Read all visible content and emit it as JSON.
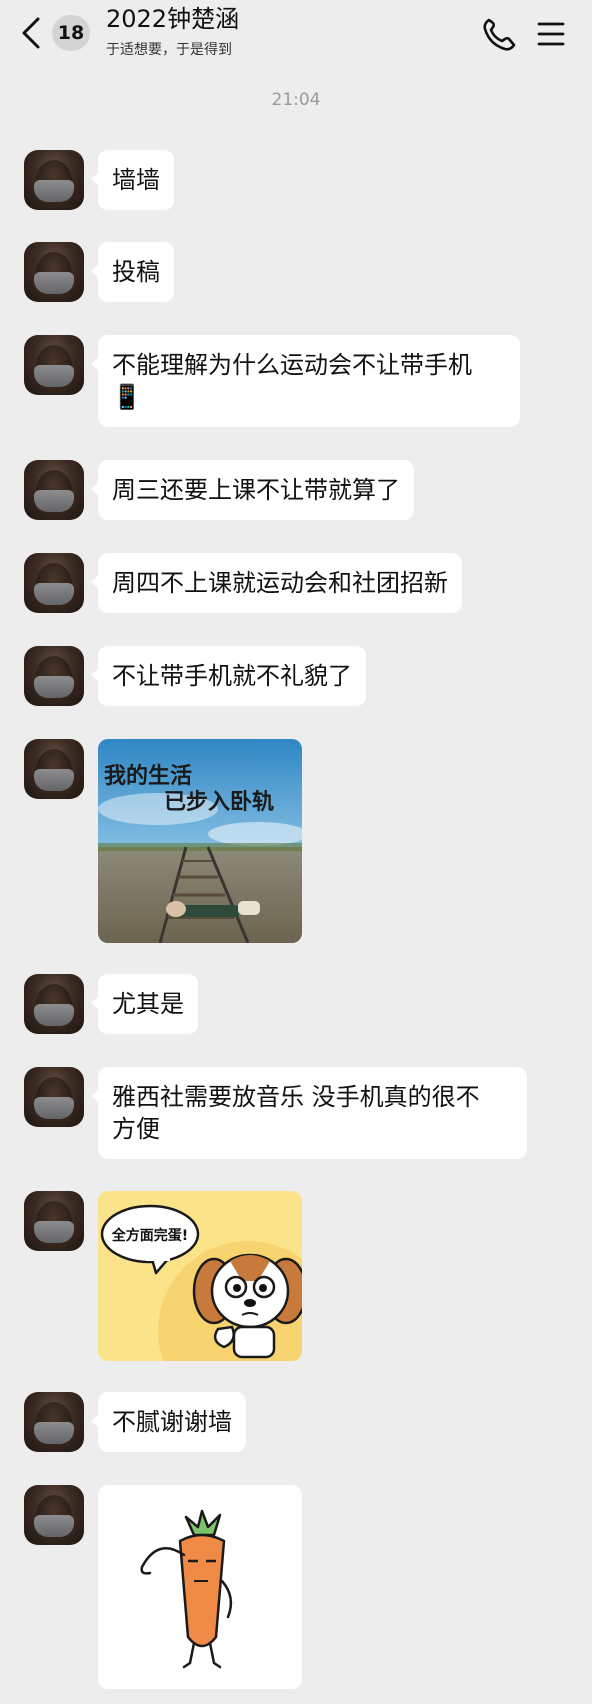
{
  "header": {
    "unread_count": "18",
    "title": "2022钟楚涵",
    "subtitle": "于适想要，于是得到"
  },
  "timestamp": "21:04",
  "messages": [
    {
      "type": "text",
      "text": "墙墙"
    },
    {
      "type": "text",
      "text": "投稿"
    },
    {
      "type": "text",
      "text": "不能理解为什么运动会不让带手机",
      "emoji": "📱"
    },
    {
      "type": "text",
      "text": "周三还要上课不让带就算了"
    },
    {
      "type": "text",
      "text": "周四不上课就运动会和社团招新"
    },
    {
      "type": "text",
      "text": "不让带手机就不礼貌了"
    },
    {
      "type": "image",
      "caption_line1": "我的生活",
      "caption_line2": "已步入卧轨"
    },
    {
      "type": "text",
      "text": "尤其是"
    },
    {
      "type": "text",
      "line1": "雅西社需要放音乐 没手机真的很不",
      "line2": "方便"
    },
    {
      "type": "image",
      "speech": "全方面完蛋!"
    },
    {
      "type": "text",
      "text": "不腻谢谢墙"
    },
    {
      "type": "image",
      "description": "carrot-sticker"
    }
  ],
  "colors": {
    "background": "#ededed",
    "bubble": "#ffffff",
    "timestamp": "#9a9a9a"
  }
}
